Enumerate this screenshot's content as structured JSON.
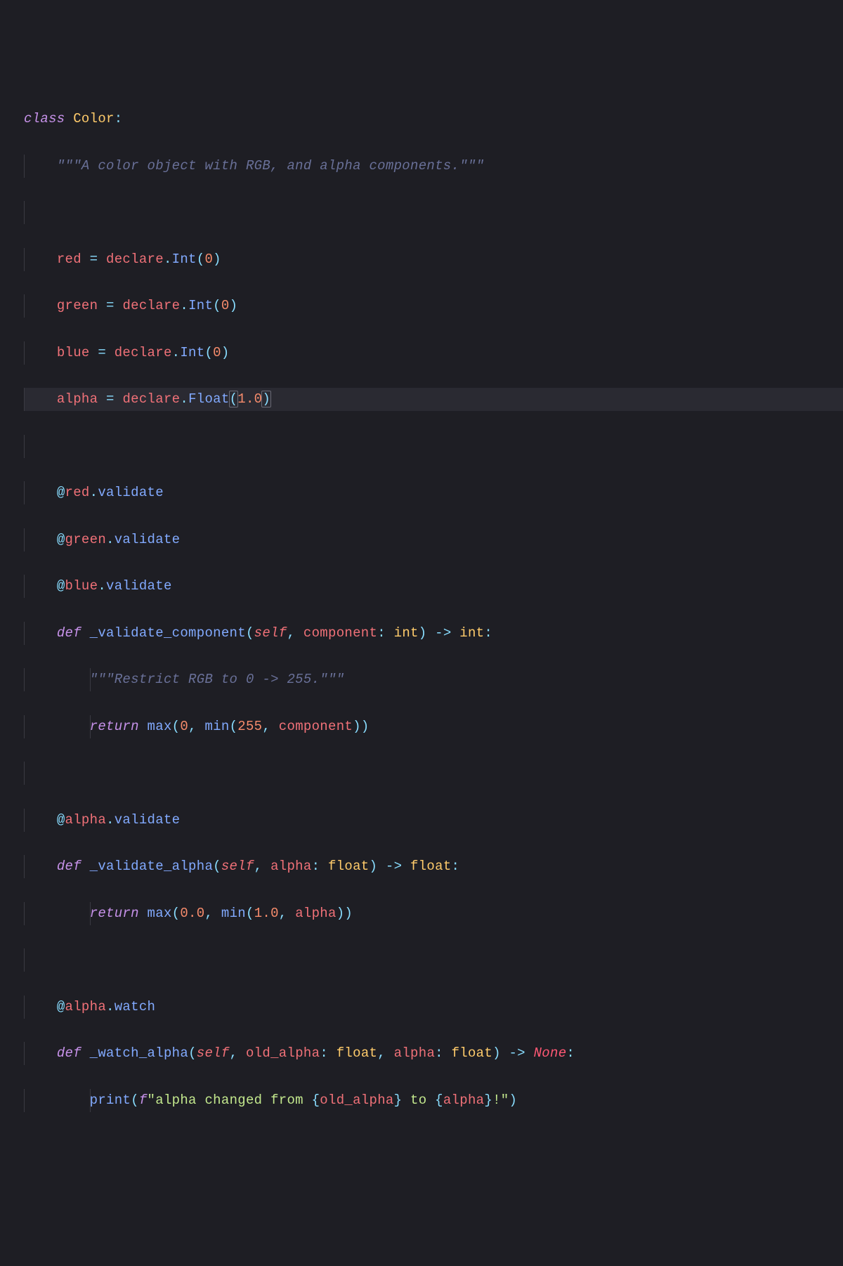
{
  "code": {
    "class_kw": "class",
    "class_name": "Color",
    "colon": ":",
    "docstring_class": "\"\"\"A color object with RGB, and alpha components.\"\"\"",
    "red": "red",
    "green": "green",
    "blue": "blue",
    "alpha": "alpha",
    "eq": " = ",
    "declare": "declare",
    "dot": ".",
    "Int": "Int",
    "Float": "Float",
    "lparen": "(",
    "rparen": ")",
    "zero": "0",
    "one_float": "1.0",
    "at": "@",
    "validate": "validate",
    "watch": "watch",
    "def_kw": "def",
    "fn_validate_component": "_validate_component",
    "fn_validate_alpha": "_validate_alpha",
    "fn_watch_alpha": "_watch_alpha",
    "self": "self",
    "comma_sp": ", ",
    "component": "component",
    "alpha_param": "alpha",
    "old_alpha": "old_alpha",
    "colon_sp": ": ",
    "int_type": "int",
    "float_type": "float",
    "arrow": " -> ",
    "None": "None",
    "docstring_restrict": "\"\"\"Restrict RGB to 0 -> 255.\"\"\"",
    "return_kw": "return",
    "max": "max",
    "min": "min",
    "n255": "255",
    "zero_float": "0.0",
    "print": "print",
    "f": "f",
    "fstr_open": "\"alpha changed from ",
    "fstr_mid": " to ",
    "fstr_end": "!\"",
    "lbrace": "{",
    "rbrace": "}"
  }
}
